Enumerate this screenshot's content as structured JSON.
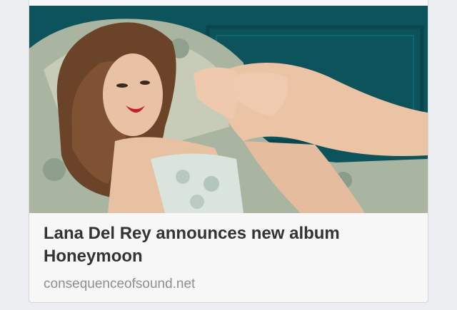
{
  "link_preview": {
    "image_description_icon": "photo-image",
    "title_line_1": "Lana Del Rey announces new album",
    "title_line_2": "Honeymoon",
    "domain": "consequenceofsound.net"
  },
  "colors": {
    "photo_background": "#0d5a63",
    "title_text": "#333333",
    "domain_text": "#8d8f94",
    "card_background": "#f7f7f7",
    "page_background": "#eceef1"
  }
}
